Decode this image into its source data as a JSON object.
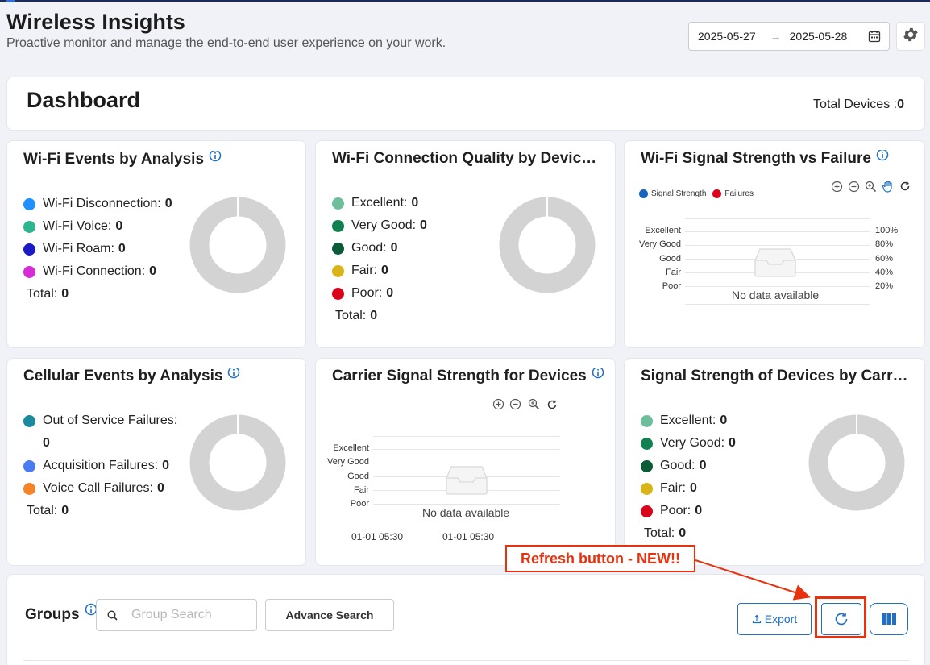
{
  "header": {
    "title": "Wireless Insights",
    "subtitle": "Proactive monitor and manage the end-to-end user experience on your work.",
    "date_from": "2025-05-27",
    "date_arrow": "→",
    "date_to": "2025-05-28"
  },
  "dashboard": {
    "title": "Dashboard",
    "total_devices_label": "Total Devices :",
    "total_devices_value": "0"
  },
  "colors": {
    "disconnection": "#1e90ff",
    "voice": "#2cb58e",
    "roam": "#1a1ac7",
    "connection": "#d62bd6",
    "excellent": "#6dbf9c",
    "very_good": "#128050",
    "good": "#0b5a38",
    "fair": "#d9b418",
    "poor": "#d9041c",
    "oos": "#1b8a9e",
    "acquisition": "#4b7bf2",
    "voice_call": "#f5832a",
    "signal": "#1565c0",
    "failures": "#d9041c",
    "donut": "#d3d3d3",
    "accent": "#1d6fc7",
    "annotation": "#e8320f"
  },
  "cards": {
    "wifi_events": {
      "title": "Wi-Fi Events by Analysis",
      "items": [
        {
          "label": "Wi-Fi Disconnection:",
          "value": "0"
        },
        {
          "label": "Wi-Fi Voice:",
          "value": "0"
        },
        {
          "label": "Wi-Fi Roam:",
          "value": "0"
        },
        {
          "label": "Wi-Fi Connection:",
          "value": "0"
        }
      ],
      "total_label": "Total:",
      "total_value": "0"
    },
    "wifi_quality": {
      "title": "Wi-Fi Connection Quality by Device…",
      "items": [
        {
          "label": "Excellent:",
          "value": "0"
        },
        {
          "label": "Very Good:",
          "value": "0"
        },
        {
          "label": "Good:",
          "value": "0"
        },
        {
          "label": "Fair:",
          "value": "0"
        },
        {
          "label": "Poor:",
          "value": "0"
        }
      ],
      "total_label": "Total:",
      "total_value": "0"
    },
    "wifi_signal": {
      "title": "Wi-Fi Signal Strength vs Failure",
      "legend": [
        "Signal Strength",
        "Failures"
      ],
      "y_labels": [
        "Excellent",
        "Very Good",
        "Good",
        "Fair",
        "Poor"
      ],
      "y2_labels": [
        "100%",
        "80%",
        "60%",
        "40%",
        "20%"
      ],
      "no_data": "No data available"
    },
    "cellular_events": {
      "title": "Cellular Events by Analysis",
      "items": [
        {
          "label": "Out of Service Failures:",
          "value": "0"
        },
        {
          "label": "Acquisition Failures:",
          "value": "0"
        },
        {
          "label": "Voice Call Failures:",
          "value": "0"
        }
      ],
      "total_label": "Total:",
      "total_value": "0"
    },
    "carrier_signal": {
      "title": "Carrier Signal Strength for Devices",
      "y_labels": [
        "Excellent",
        "Very Good",
        "Good",
        "Fair",
        "Poor"
      ],
      "x_labels": [
        "01-01 05:30",
        "01-01 05:30"
      ],
      "no_data": "No data available"
    },
    "carrier_strength": {
      "title": "Signal Strength of Devices by Carrie…",
      "items": [
        {
          "label": "Excellent:",
          "value": "0"
        },
        {
          "label": "Very Good:",
          "value": "0"
        },
        {
          "label": "Good:",
          "value": "0"
        },
        {
          "label": "Fair:",
          "value": "0"
        },
        {
          "label": "Poor:",
          "value": "0"
        }
      ],
      "total_label": "Total:",
      "total_value": "0"
    }
  },
  "annotation": {
    "text": "Refresh button - NEW!!"
  },
  "groups": {
    "title": "Groups",
    "search_placeholder": "Group Search",
    "advance_search_label": "Advance Search",
    "export_label": "Export"
  }
}
